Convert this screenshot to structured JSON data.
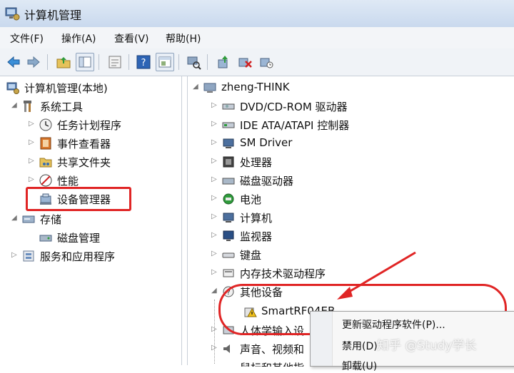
{
  "window": {
    "title": "计算机管理"
  },
  "menu": {
    "items": [
      {
        "label": "文件(F)"
      },
      {
        "label": "操作(A)"
      },
      {
        "label": "查看(V)"
      },
      {
        "label": "帮助(H)"
      }
    ]
  },
  "toolbar": {
    "icons": [
      "back-icon",
      "forward-icon",
      "up-folder-icon",
      "show-tree-icon",
      "properties-icon",
      "help-icon",
      "console-icon",
      "scan-hardware-icon",
      "update-driver-icon",
      "uninstall-icon",
      "disable-icon"
    ]
  },
  "left_tree": {
    "root": "计算机管理(本地)",
    "system_tools": "系统工具",
    "task_scheduler": "任务计划程序",
    "event_viewer": "事件查看器",
    "shared_folders": "共享文件夹",
    "performance": "性能",
    "device_manager": "设备管理器",
    "storage": "存储",
    "disk_management": "磁盘管理",
    "services_apps": "服务和应用程序"
  },
  "right_tree": {
    "computer_name": "zheng-THINK",
    "items": [
      {
        "label": "DVD/CD-ROM 驱动器"
      },
      {
        "label": "IDE ATA/ATAPI 控制器"
      },
      {
        "label": "SM Driver"
      },
      {
        "label": "处理器"
      },
      {
        "label": "磁盘驱动器"
      },
      {
        "label": "电池"
      },
      {
        "label": "计算机"
      },
      {
        "label": "监视器"
      },
      {
        "label": "键盘"
      },
      {
        "label": "内存技术驱动程序"
      },
      {
        "label": "其他设备"
      }
    ],
    "smart_device": "SmartRF04EB",
    "hid": "人体学输入设",
    "sound": "声音、视频和",
    "partial_last": "鼠标和其他指"
  },
  "context_menu": {
    "update_driver": "更新驱动程序软件(P)...",
    "disable": "禁用(D)",
    "uninstall": "卸载(U)"
  },
  "watermark": "知乎 @Study学长",
  "colors": {
    "highlight": "#e02525",
    "titlebar": "#c9d9ee"
  }
}
